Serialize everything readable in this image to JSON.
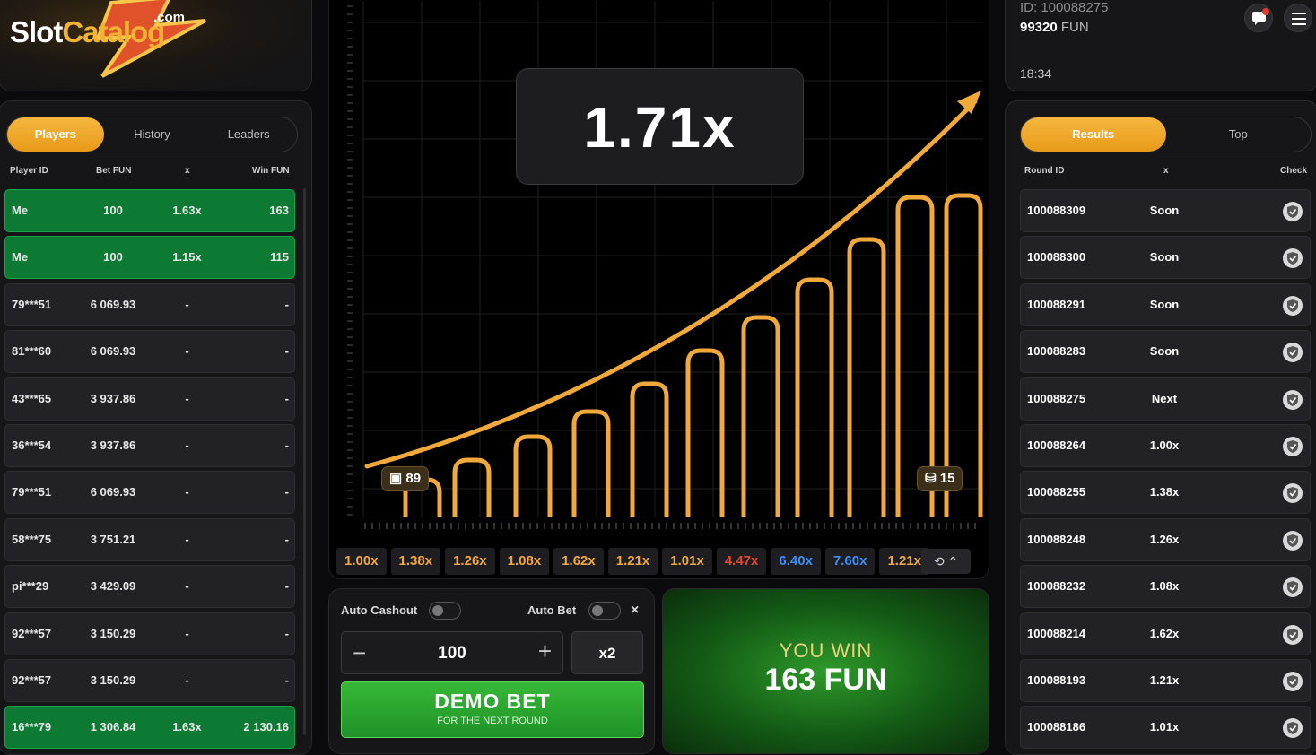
{
  "logo": {
    "word1": "Slot",
    "word2": "Catalog",
    "tld": ".com"
  },
  "players": {
    "tabs": [
      "Players",
      "History",
      "Leaders"
    ],
    "columns": {
      "id": "Player ID",
      "bet": "Bet FUN",
      "x": "x",
      "win": "Win FUN"
    },
    "rows": [
      {
        "id": "Me",
        "bet": "100",
        "x": "1.63x",
        "win": "163",
        "won": true
      },
      {
        "id": "Me",
        "bet": "100",
        "x": "1.15x",
        "win": "115",
        "won": true
      },
      {
        "id": "79***51",
        "bet": "6 069.93",
        "x": "-",
        "win": "-"
      },
      {
        "id": "81***60",
        "bet": "6 069.93",
        "x": "-",
        "win": "-"
      },
      {
        "id": "43***65",
        "bet": "3 937.86",
        "x": "-",
        "win": "-"
      },
      {
        "id": "36***54",
        "bet": "3 937.86",
        "x": "-",
        "win": "-"
      },
      {
        "id": "79***51",
        "bet": "6 069.93",
        "x": "-",
        "win": "-"
      },
      {
        "id": "58***75",
        "bet": "3 751.21",
        "x": "-",
        "win": "-"
      },
      {
        "id": "pi***29",
        "bet": "3 429.09",
        "x": "-",
        "win": "-"
      },
      {
        "id": "92***57",
        "bet": "3 150.29",
        "x": "-",
        "win": "-"
      },
      {
        "id": "92***57",
        "bet": "3 150.29",
        "x": "-",
        "win": "-"
      },
      {
        "id": "16***79",
        "bet": "1 306.84",
        "x": "1.63x",
        "win": "2 130.16",
        "won": true
      }
    ]
  },
  "game": {
    "multiplier": "1.71x",
    "players_count": "89",
    "bets_count": "15",
    "colors": {
      "curve": "#f2a93b",
      "accent": "#f2a93b"
    },
    "history": [
      {
        "v": "1.00x",
        "c": "y"
      },
      {
        "v": "1.38x",
        "c": "y"
      },
      {
        "v": "1.26x",
        "c": "y"
      },
      {
        "v": "1.08x",
        "c": "y"
      },
      {
        "v": "1.62x",
        "c": "y"
      },
      {
        "v": "1.21x",
        "c": "y"
      },
      {
        "v": "1.01x",
        "c": "y"
      },
      {
        "v": "4.47x",
        "c": "r"
      },
      {
        "v": "6.40x",
        "c": "b"
      },
      {
        "v": "7.60x",
        "c": "b"
      },
      {
        "v": "1.21x",
        "c": "y"
      }
    ]
  },
  "bet": {
    "auto_cashout": "Auto Cashout",
    "auto_bet": "Auto Bet",
    "close": "×",
    "amount": "100",
    "minus": "−",
    "plus": "+",
    "x2": "x2",
    "demo_bet": "DEMO BET",
    "demo_sub": "FOR THE NEXT ROUND"
  },
  "win": {
    "label": "YOU WIN",
    "amount": "163",
    "currency": "FUN"
  },
  "user": {
    "id": "ID: 100088275",
    "balance": "99320",
    "currency": "FUN",
    "time": "18:34"
  },
  "results": {
    "tabs": [
      "Results",
      "Top"
    ],
    "columns": {
      "round": "Round ID",
      "x": "x",
      "check": "Check"
    },
    "rows": [
      {
        "id": "100088309",
        "x": "Soon"
      },
      {
        "id": "100088300",
        "x": "Soon"
      },
      {
        "id": "100088291",
        "x": "Soon"
      },
      {
        "id": "100088283",
        "x": "Soon"
      },
      {
        "id": "100088275",
        "x": "Next"
      },
      {
        "id": "100088264",
        "x": "1.00x"
      },
      {
        "id": "100088255",
        "x": "1.38x"
      },
      {
        "id": "100088248",
        "x": "1.26x"
      },
      {
        "id": "100088232",
        "x": "1.08x"
      },
      {
        "id": "100088214",
        "x": "1.62x"
      },
      {
        "id": "100088193",
        "x": "1.21x"
      },
      {
        "id": "100088186",
        "x": "1.01x"
      }
    ]
  }
}
